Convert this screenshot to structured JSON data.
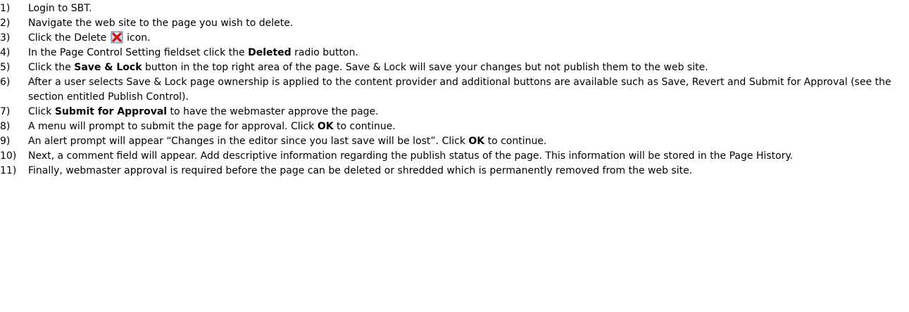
{
  "steps": [
    {
      "num": "1)",
      "parts": [
        {
          "t": "Login to SBT."
        }
      ]
    },
    {
      "num": "2)",
      "parts": [
        {
          "t": "Navigate the web site to the page you wish to delete."
        }
      ]
    },
    {
      "num": "3)",
      "parts": [
        {
          "t": "Click the Delete "
        },
        {
          "icon": "delete-icon"
        },
        {
          "t": " icon."
        }
      ]
    },
    {
      "num": "4)",
      "parts": [
        {
          "t": "In the Page Control Setting fieldset click the "
        },
        {
          "b": "Deleted"
        },
        {
          "t": " radio button."
        }
      ]
    },
    {
      "num": "5)",
      "parts": [
        {
          "t": "Click the "
        },
        {
          "b": "Save & Lock"
        },
        {
          "t": " button in the top right area of the page.  Save & Lock will save your changes but not publish them to the web site."
        }
      ]
    },
    {
      "num": "6)",
      "parts": [
        {
          "t": "After a user selects Save & Lock page ownership is applied to the content provider and additional buttons are available such as Save, Revert and Submit for Approval (see the section entitled Publish Control)."
        }
      ]
    },
    {
      "num": "7)",
      "parts": [
        {
          "t": "Click "
        },
        {
          "b": "Submit for Approval"
        },
        {
          "t": " to have the webmaster approve the page."
        }
      ]
    },
    {
      "num": "8)",
      "parts": [
        {
          "t": "A menu will prompt to submit the page for approval.  Click "
        },
        {
          "b": "OK"
        },
        {
          "t": " to continue."
        }
      ]
    },
    {
      "num": "9)",
      "parts": [
        {
          "t": "An alert prompt will appear “Changes in the editor since you last save will be lost”.  Click "
        },
        {
          "b": "OK"
        },
        {
          "t": " to continue."
        }
      ]
    },
    {
      "num": "10)",
      "parts": [
        {
          "t": "Next, a comment field will appear.  Add descriptive information regarding the publish status of the page.  This information will be stored in the Page History."
        }
      ]
    },
    {
      "num": "11)",
      "parts": [
        {
          "t": "Finally, webmaster approval is required before the page can be deleted or shredded which is permanently removed from the web site."
        }
      ]
    }
  ],
  "icons": {
    "delete-icon": {
      "bg": "#c8dcf0",
      "x_color": "#e02020"
    }
  }
}
